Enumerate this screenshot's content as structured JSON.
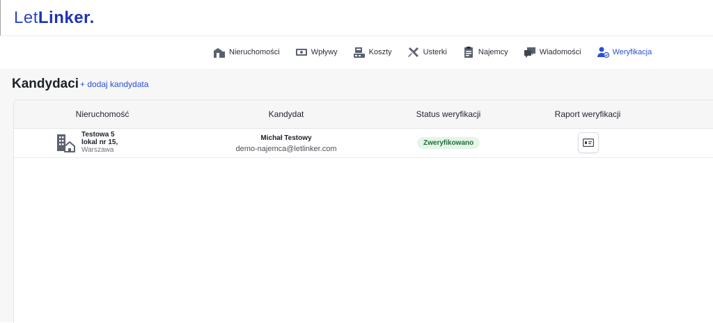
{
  "brand": {
    "light": "Let",
    "bold": "Linker",
    "dot": "."
  },
  "nav": [
    {
      "label": "Nieruchomości",
      "icon": "building-icon"
    },
    {
      "label": "Wpływy",
      "icon": "cash-icon"
    },
    {
      "label": "Koszty",
      "icon": "register-icon"
    },
    {
      "label": "Usterki",
      "icon": "tools-icon"
    },
    {
      "label": "Najemcy",
      "icon": "clipboard-icon"
    },
    {
      "label": "Wiadomości",
      "icon": "chat-icon"
    },
    {
      "label": "Weryfikacja",
      "icon": "user-check-icon",
      "active": true
    }
  ],
  "page": {
    "title": "Kandydaci",
    "add_link": "+ dodaj kandydata"
  },
  "table": {
    "headers": [
      "Nieruchomość",
      "Kandydat",
      "Status weryfikacji",
      "Raport weryfikacji"
    ],
    "rows": [
      {
        "property_line1": "Testowa 5",
        "property_line2": "lokal nr 15,",
        "property_city": "Warszawa",
        "candidate_name": "Michał Testowy",
        "candidate_email": "demo-najemca@letlinker.com",
        "status": "Zweryfikowano",
        "report_icon": "id-card-icon"
      }
    ]
  },
  "colors": {
    "accent": "#2a4fd1",
    "brand": "#1c33b8",
    "status_bg": "#e6f4ea",
    "status_text": "#1f6e34"
  }
}
